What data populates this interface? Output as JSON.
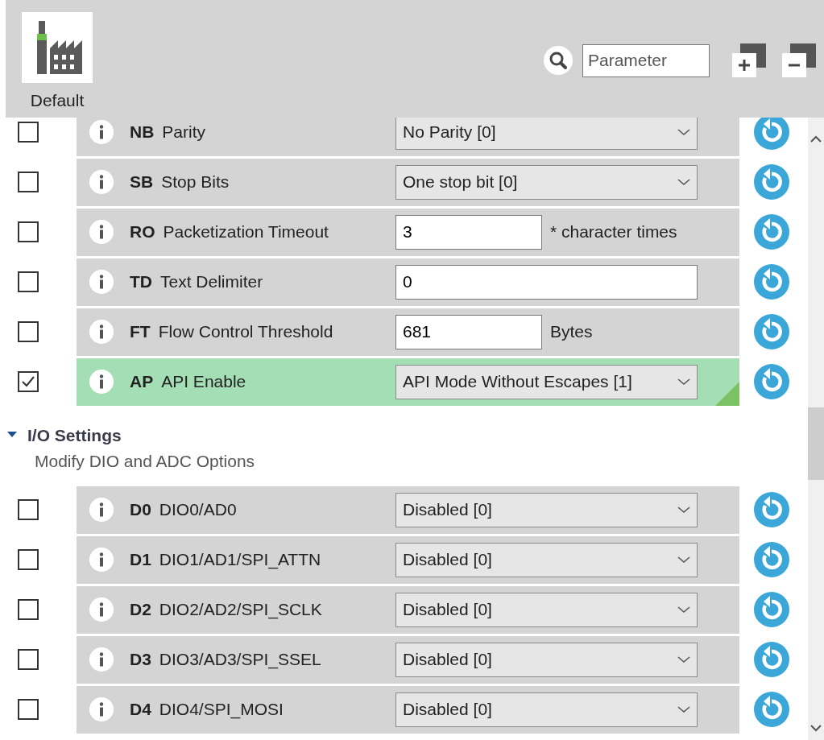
{
  "profile": {
    "label": "Default"
  },
  "search": {
    "placeholder": "Parameter"
  },
  "groups": [
    {
      "rows": [
        {
          "code": "NB",
          "name": "Parity",
          "checked": false,
          "changed": false,
          "kind": "select",
          "value": "No Parity [0]"
        },
        {
          "code": "SB",
          "name": "Stop Bits",
          "checked": false,
          "changed": false,
          "kind": "select",
          "value": "One stop bit [0]"
        },
        {
          "code": "RO",
          "name": "Packetization Timeout",
          "checked": false,
          "changed": false,
          "kind": "text",
          "value": "3",
          "unit": "* character times"
        },
        {
          "code": "TD",
          "name": "Text Delimiter",
          "checked": false,
          "changed": false,
          "kind": "wide-text",
          "value": "0"
        },
        {
          "code": "FT",
          "name": "Flow Control Threshold",
          "checked": false,
          "changed": false,
          "kind": "text",
          "value": "681",
          "unit": "Bytes"
        },
        {
          "code": "AP",
          "name": "API Enable",
          "checked": true,
          "changed": true,
          "kind": "select",
          "value": "API Mode Without Escapes [1]"
        }
      ]
    },
    {
      "title": "I/O Settings",
      "subtitle": "Modify DIO and ADC Options",
      "expanded": true,
      "rows": [
        {
          "code": "D0",
          "name": "DIO0/AD0",
          "checked": false,
          "changed": false,
          "kind": "select",
          "value": "Disabled [0]"
        },
        {
          "code": "D1",
          "name": "DIO1/AD1/SPI_ATTN",
          "checked": false,
          "changed": false,
          "kind": "select",
          "value": "Disabled [0]"
        },
        {
          "code": "D2",
          "name": "DIO2/AD2/SPI_SCLK",
          "checked": false,
          "changed": false,
          "kind": "select",
          "value": "Disabled [0]"
        },
        {
          "code": "D3",
          "name": "DIO3/AD3/SPI_SSEL",
          "checked": false,
          "changed": false,
          "kind": "select",
          "value": "Disabled [0]"
        },
        {
          "code": "D4",
          "name": "DIO4/SPI_MOSI",
          "checked": false,
          "changed": false,
          "kind": "select",
          "value": "Disabled [0]"
        }
      ]
    }
  ]
}
